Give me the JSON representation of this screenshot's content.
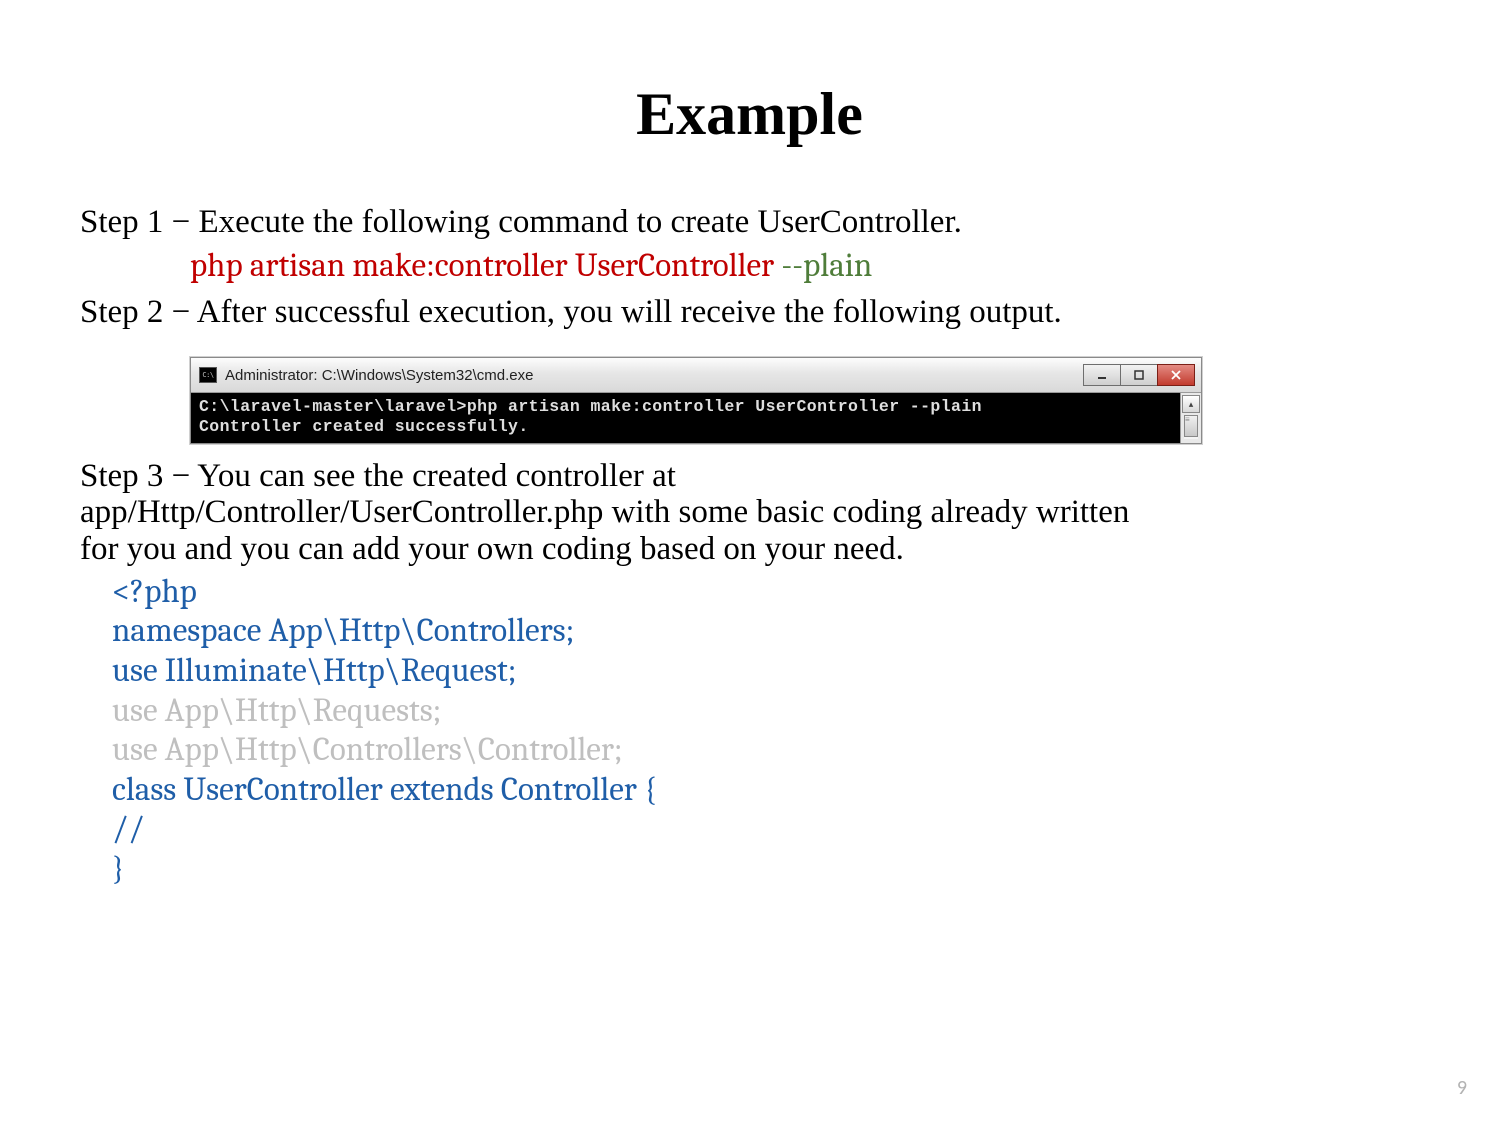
{
  "title": "Example",
  "step1": {
    "label": "Step 1 − Execute the following command to create UserController.",
    "command_main": "php artisan make:controller UserController ",
    "command_flag": "--plain"
  },
  "step2": {
    "label": "Step 2 − After successful execution, you will receive the following output."
  },
  "cmd": {
    "window_title": "Administrator: C:\\Windows\\System32\\cmd.exe",
    "line1": "C:\\laravel-master\\laravel>php artisan make:controller UserController --plain",
    "line2": "Controller created successfully."
  },
  "step3": {
    "line_a": "Step 3 − You can see the created controller at",
    "line_b": "app/Http/Controller/UserController.php with some basic coding already written",
    "line_c": "for you and you can add your own coding based on your need."
  },
  "code": {
    "l1": "<?php",
    "l2": "namespace App\\Http\\Controllers;",
    "l3": "use Illuminate\\Http\\Request;",
    "l4": "use App\\Http\\Requests;",
    "l5": "use App\\Http\\Controllers\\Controller;",
    "l6": "",
    "l7": "class UserController extends Controller {",
    "l8": "  //",
    "l9": "}"
  },
  "page_number": "9"
}
